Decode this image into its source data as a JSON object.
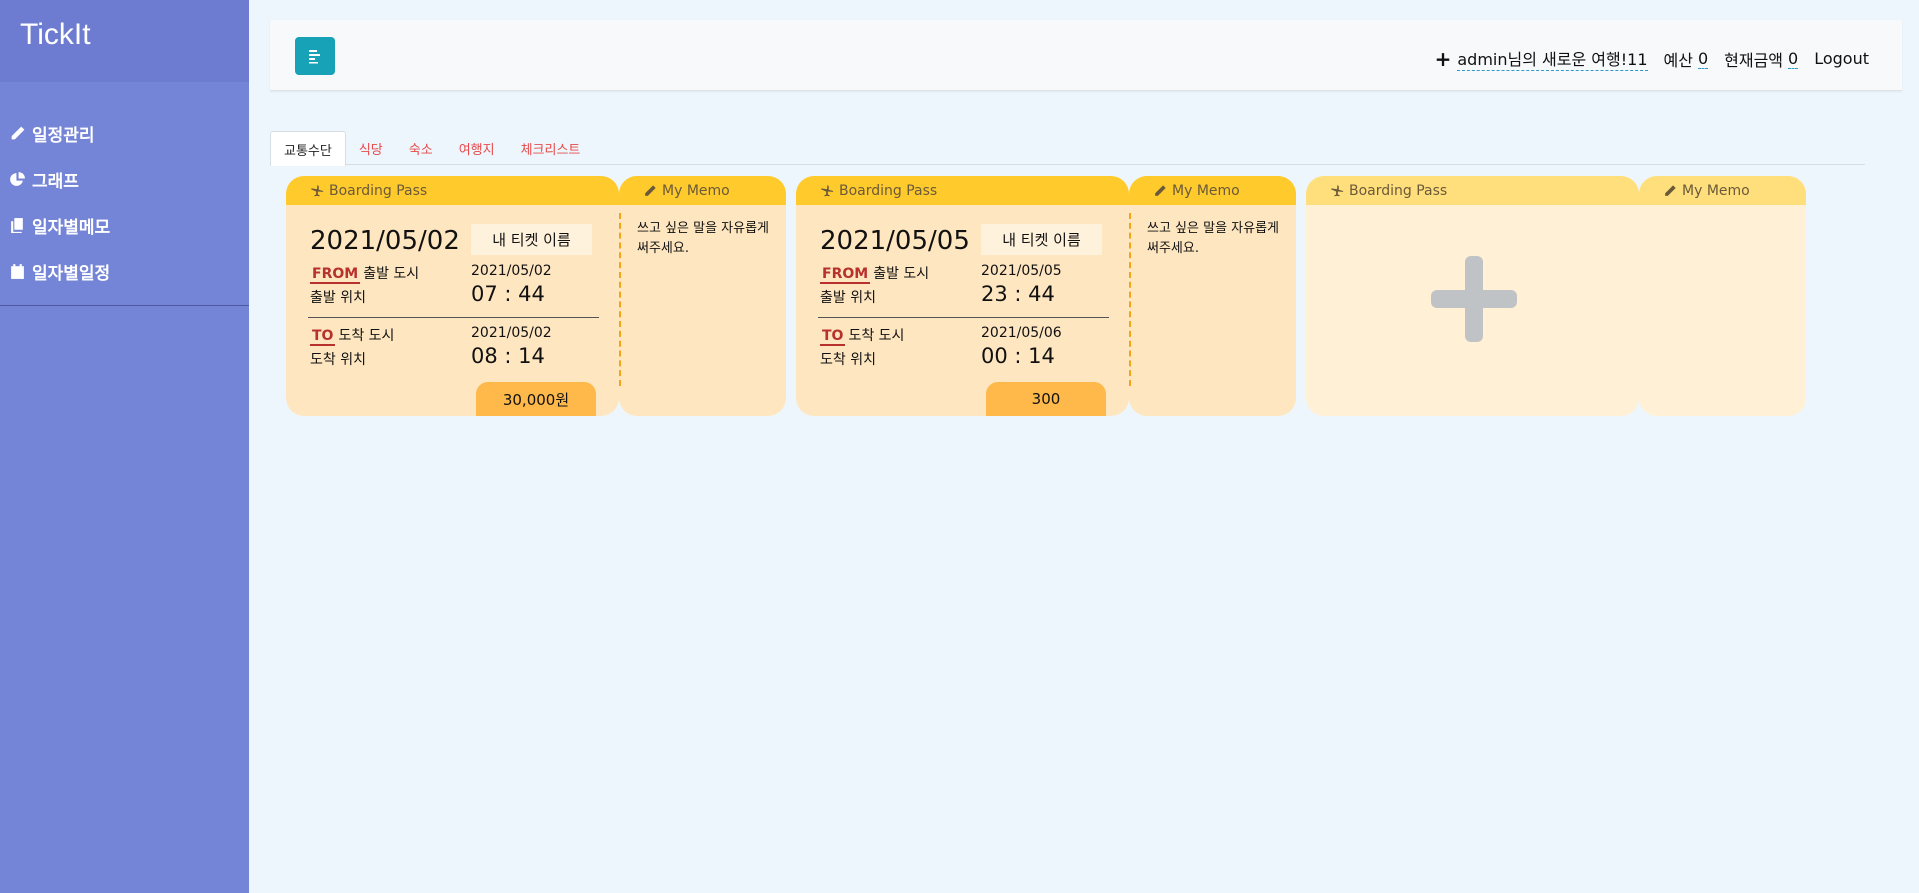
{
  "app": {
    "brand": "TickIt"
  },
  "sidebar": {
    "items": [
      {
        "label": "일정관리",
        "icon": "pencil-icon"
      },
      {
        "label": "그래프",
        "icon": "pie-chart-icon"
      },
      {
        "label": "일자별메모",
        "icon": "copy-icon"
      },
      {
        "label": "일자별일정",
        "icon": "calendar-icon"
      }
    ]
  },
  "header": {
    "menu_icon": "align-left-icon",
    "plus": "+",
    "trip_title": "admin님의 새로운 여행!11",
    "budget_label": "예산",
    "budget_value": "0",
    "current_label": "현재금액",
    "current_value": "0",
    "logout": "Logout"
  },
  "tabs": [
    {
      "label": "교통수단",
      "active": true
    },
    {
      "label": "식당"
    },
    {
      "label": "숙소"
    },
    {
      "label": "여행지"
    },
    {
      "label": "체크리스트"
    }
  ],
  "tickets": [
    {
      "header": "Boarding Pass",
      "memo_header": "My Memo",
      "date": "2021/05/02",
      "name": "내 티켓 이름",
      "from_tag": "FROM",
      "from_city": "출발 도시",
      "from_place": "출발 위치",
      "from_date": "2021/05/02",
      "from_time": "07 : 44",
      "to_tag": "TO",
      "to_city": "도착 도시",
      "to_place": "도착 위치",
      "to_date": "2021/05/02",
      "to_time": "08 : 14",
      "price": "30,000원",
      "memo": "쓰고 싶은 말을 자유롭게 써주세요."
    },
    {
      "header": "Boarding Pass",
      "memo_header": "My Memo",
      "date": "2021/05/05",
      "name": "내 티켓 이름",
      "from_tag": "FROM",
      "from_city": "출발 도시",
      "from_place": "출발 위치",
      "from_date": "2021/05/05",
      "from_time": "23 : 44",
      "to_tag": "TO",
      "to_city": "도착 도시",
      "to_place": "도착 위치",
      "to_date": "2021/05/06",
      "to_time": "00 : 14",
      "price": "300",
      "memo": "쓰고 싶은 말을 자유롭게 써주세요."
    }
  ],
  "empty_ticket": {
    "header": "Boarding Pass",
    "memo_header": "My Memo",
    "add_icon": "plus-icon"
  },
  "colors": {
    "sidebar": "#7484d6",
    "ticket_header": "#ffca2c",
    "ticket_body": "#fee6c1",
    "price": "#ffb84a",
    "accent": "#17a2b8",
    "tag": "#b7312d"
  }
}
